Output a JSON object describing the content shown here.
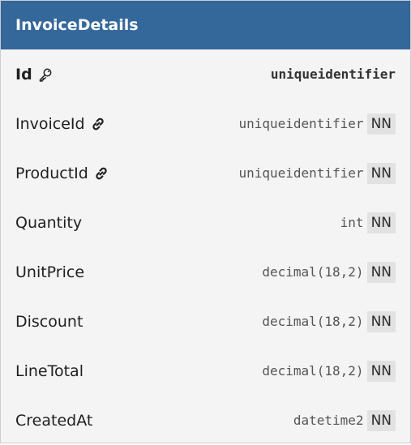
{
  "table": {
    "title": "InvoiceDetails",
    "columns": [
      {
        "name": "Id",
        "type": "uniqueidentifier",
        "pk": true,
        "fk": false,
        "nn": ""
      },
      {
        "name": "InvoiceId",
        "type": "uniqueidentifier",
        "pk": false,
        "fk": true,
        "nn": "NN"
      },
      {
        "name": "ProductId",
        "type": "uniqueidentifier",
        "pk": false,
        "fk": true,
        "nn": "NN"
      },
      {
        "name": "Quantity",
        "type": "int",
        "pk": false,
        "fk": false,
        "nn": "NN"
      },
      {
        "name": "UnitPrice",
        "type": "decimal(18,2)",
        "pk": false,
        "fk": false,
        "nn": "NN"
      },
      {
        "name": "Discount",
        "type": "decimal(18,2)",
        "pk": false,
        "fk": false,
        "nn": "NN"
      },
      {
        "name": "LineTotal",
        "type": "decimal(18,2)",
        "pk": false,
        "fk": false,
        "nn": "NN"
      },
      {
        "name": "CreatedAt",
        "type": "datetime2",
        "pk": false,
        "fk": false,
        "nn": "NN"
      }
    ]
  },
  "colors": {
    "header": "#34679a",
    "body": "#f4f4f4",
    "badge": "#e2e2e2"
  },
  "icons": {
    "primary_key": "key-icon",
    "foreign_key": "link-icon"
  }
}
